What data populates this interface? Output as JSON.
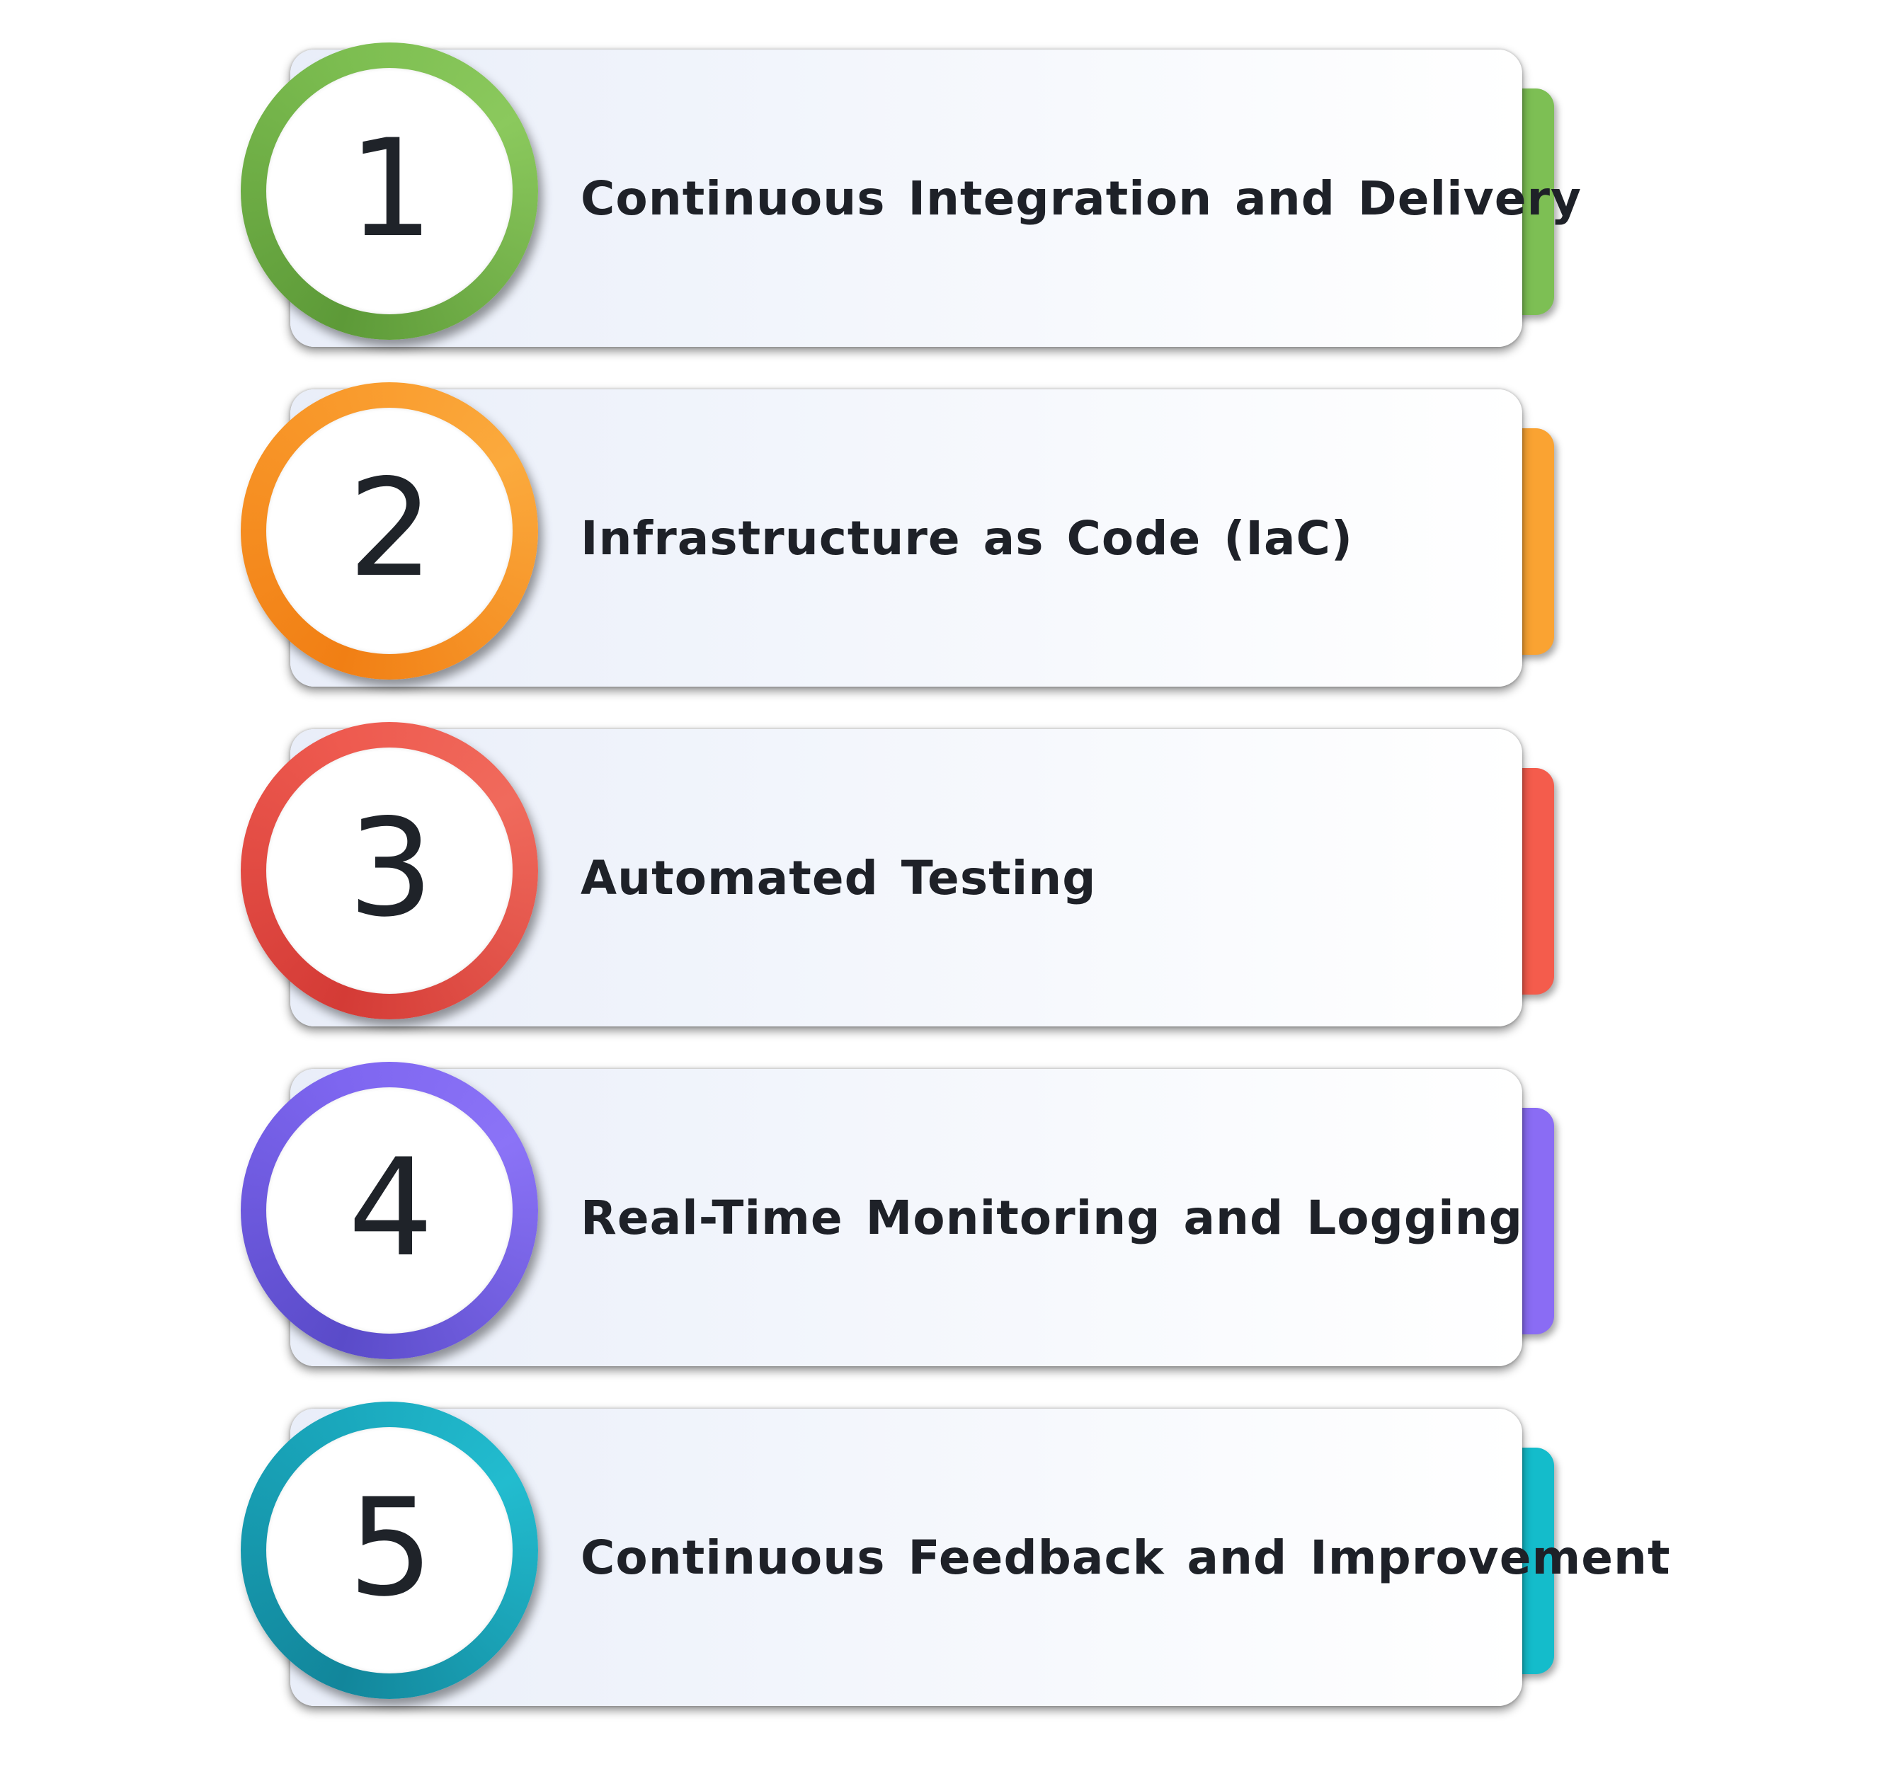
{
  "steps": [
    {
      "number": "1",
      "label": "Continuous Integration and Delivery",
      "color": "#7dbf54"
    },
    {
      "number": "2",
      "label": "Infrastructure as Code (IaC)",
      "color": "#faa332"
    },
    {
      "number": "3",
      "label": "Automated Testing",
      "color": "#f45c4c"
    },
    {
      "number": "4",
      "label": "Real-Time Monitoring and Logging",
      "color": "#8a6cf4"
    },
    {
      "number": "5",
      "label": "Continuous Feedback and Improvement",
      "color": "#14bccb"
    }
  ]
}
